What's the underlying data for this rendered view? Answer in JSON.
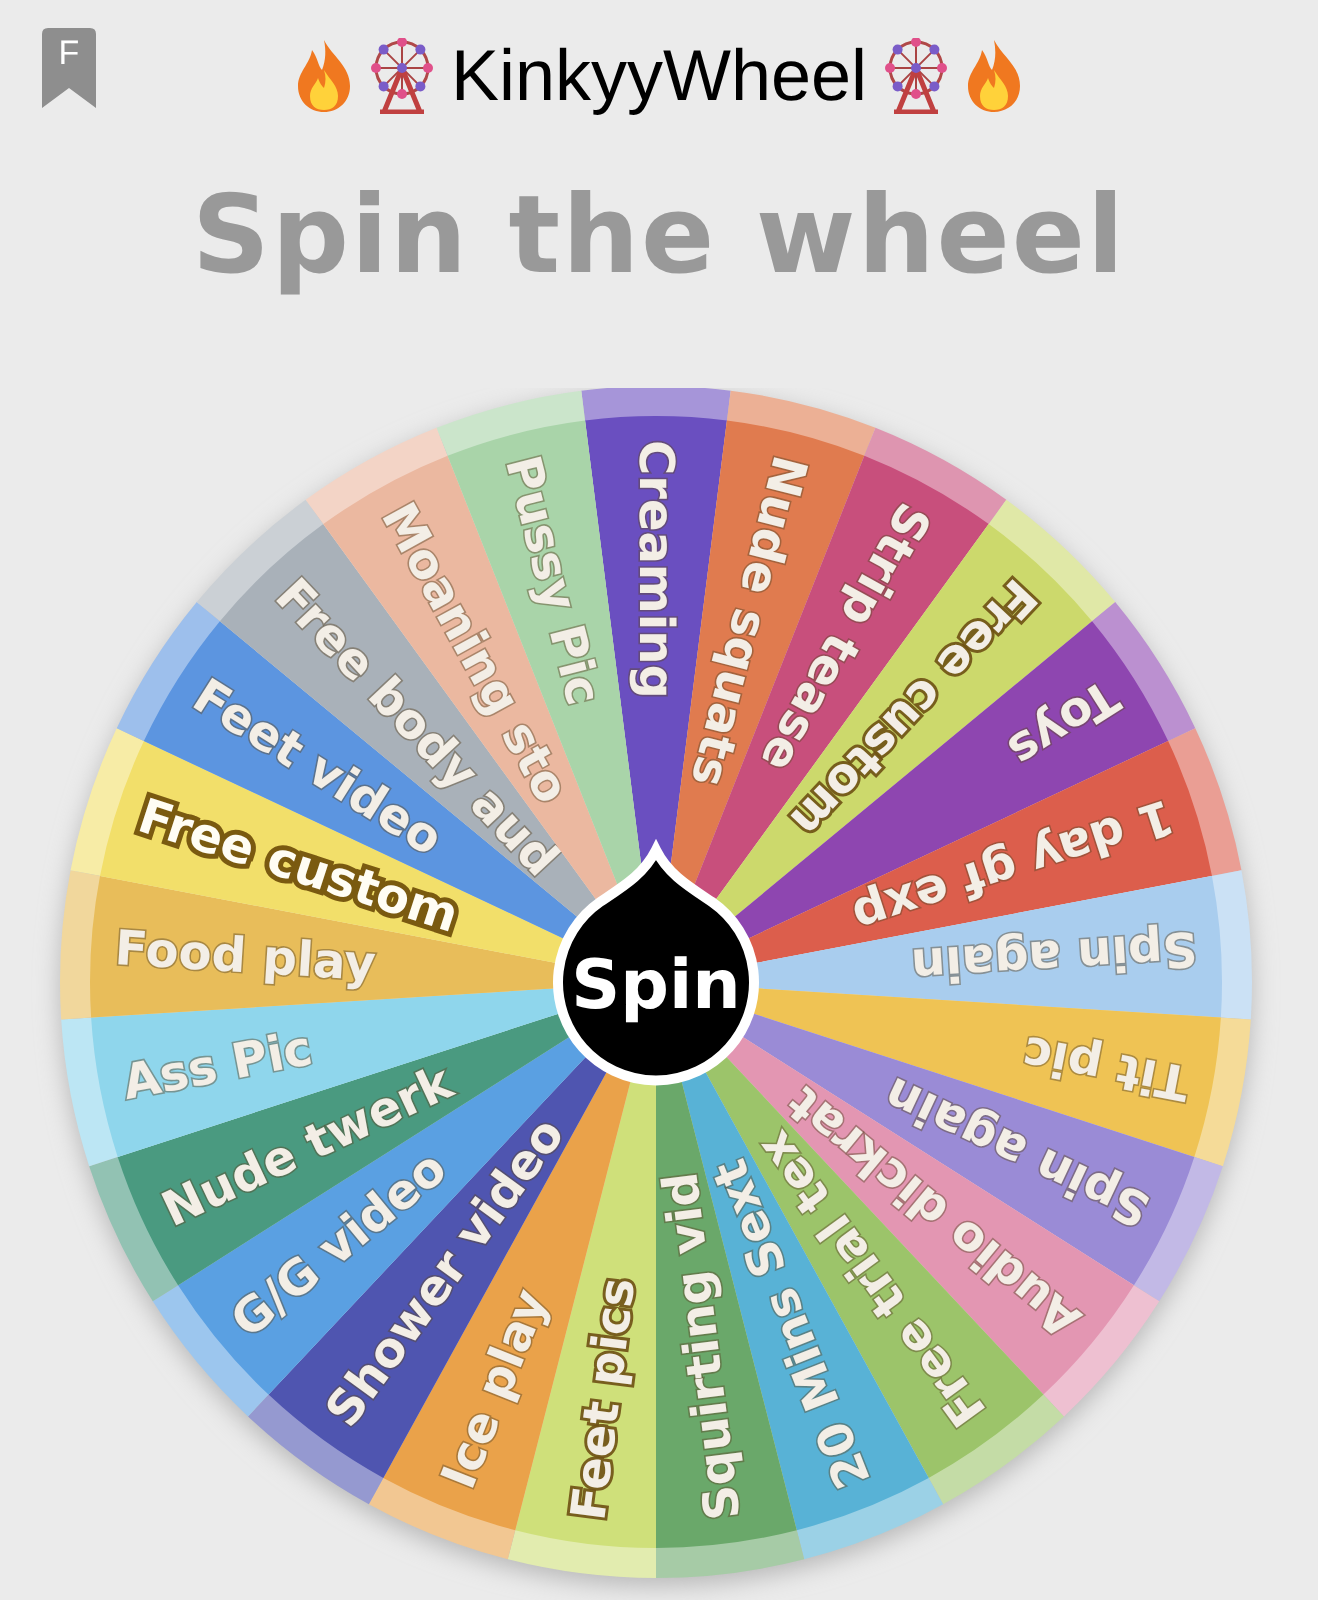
{
  "header": {
    "badge": "F",
    "title": "KinkyyWheel"
  },
  "heading": "Spin the wheel",
  "wheel": {
    "button": "Spin",
    "segments": [
      {
        "label": "Creaming",
        "color": "#6a4fc0"
      },
      {
        "label": "Nude squats",
        "color": "#e07b4f"
      },
      {
        "label": "Strip tease",
        "color": "#c84f7c"
      },
      {
        "label": "Free custom",
        "color": "#ccd96c"
      },
      {
        "label": "Toys",
        "color": "#8e46b0"
      },
      {
        "label": "1 day gf exp",
        "color": "#dc5e4c"
      },
      {
        "label": "Spin again",
        "color": "#a9cdee"
      },
      {
        "label": "Tit pic",
        "color": "#efc354"
      },
      {
        "label": "Spin again",
        "color": "#9a8bd6"
      },
      {
        "label": "Audio dickrat",
        "color": "#e396b2"
      },
      {
        "label": "Free trial tex",
        "color": "#9cc46a"
      },
      {
        "label": "20 Mins Sext",
        "color": "#58b2d6"
      },
      {
        "label": "Squirting vid",
        "color": "#6aa86a"
      },
      {
        "label": "Feet pics",
        "color": "#cfe07a"
      },
      {
        "label": "Ice play",
        "color": "#eaa24a"
      },
      {
        "label": "Shower video",
        "color": "#4f55b0"
      },
      {
        "label": "G/G video",
        "color": "#5aa0e2"
      },
      {
        "label": "Nude twerk",
        "color": "#4a9a80"
      },
      {
        "label": "Ass Pic",
        "color": "#8fd6ec"
      },
      {
        "label": "Food play",
        "color": "#e8bd5a"
      },
      {
        "label": "Free custom",
        "color": "#f2df6a"
      },
      {
        "label": "Feet video",
        "color": "#5c95e0"
      },
      {
        "label": "Free body aud",
        "color": "#a9b1b9"
      },
      {
        "label": "Moaning sto",
        "color": "#ebb8a0"
      },
      {
        "label": "Pussy Pic",
        "color": "#a9d4a9"
      }
    ]
  }
}
